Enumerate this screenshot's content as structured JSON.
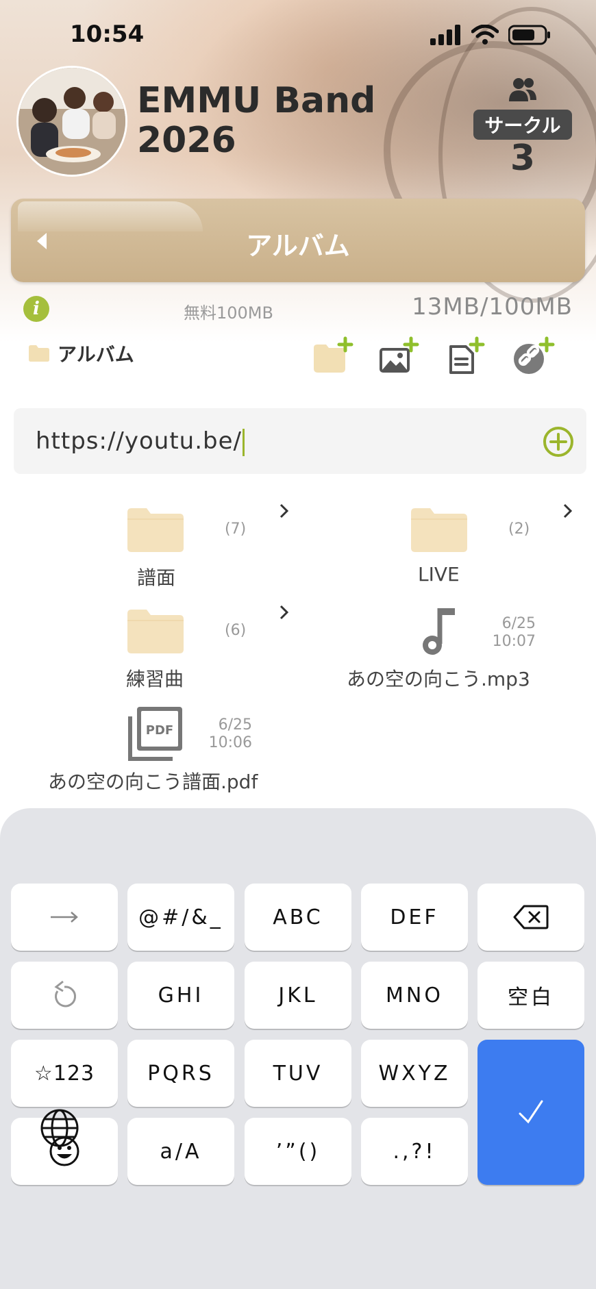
{
  "status_bar": {
    "time": "10:54"
  },
  "group": {
    "title_line1": "EMMU Band",
    "title_line2": "2026"
  },
  "circle": {
    "label": "サークル",
    "count": "3"
  },
  "album_bar": {
    "title": "アルバム"
  },
  "storage": {
    "plan": "無料100MB",
    "usage": "13MB/100MB"
  },
  "breadcrumb": {
    "label": "アルバム"
  },
  "url_input": {
    "value": "https://youtu.be/"
  },
  "files": [
    {
      "name": "譜面",
      "type": "folder",
      "count": "(7)"
    },
    {
      "name": "LIVE",
      "type": "folder",
      "count": "(2)"
    },
    {
      "name": "練習曲",
      "type": "folder",
      "count": "(6)"
    },
    {
      "name": "あの空の向こう.mp3",
      "type": "audio",
      "date": "6/25",
      "time": "10:07"
    },
    {
      "name": "あの空の向こう譜面.pdf",
      "type": "pdf",
      "date": "6/25",
      "time": "10:06"
    }
  ],
  "keyboard": {
    "row1": [
      "→",
      "@#/&_",
      "ABC",
      "DEF"
    ],
    "row2": [
      "GHI",
      "JKL",
      "MNO",
      "空白"
    ],
    "row3": [
      "☆123",
      "PQRS",
      "TUV",
      "WXYZ"
    ],
    "row4": [
      "a/A",
      "’”()",
      ".,?!"
    ]
  },
  "colors": {
    "accent_green": "#a5bf3c",
    "header_bar": "#cdb58f",
    "confirm_key": "#3d7cf0"
  },
  "icons": [
    "signal-icon",
    "wifi-icon",
    "battery-icon",
    "members-icon",
    "back-arrow-icon",
    "info-icon",
    "folder-icon",
    "add-folder-icon",
    "add-photo-icon",
    "add-document-icon",
    "add-link-icon",
    "add-circle-icon",
    "chevron-right-icon",
    "music-note-icon",
    "pdf-file-icon",
    "backspace-icon",
    "undo-icon",
    "emoji-icon",
    "check-icon",
    "globe-icon"
  ]
}
